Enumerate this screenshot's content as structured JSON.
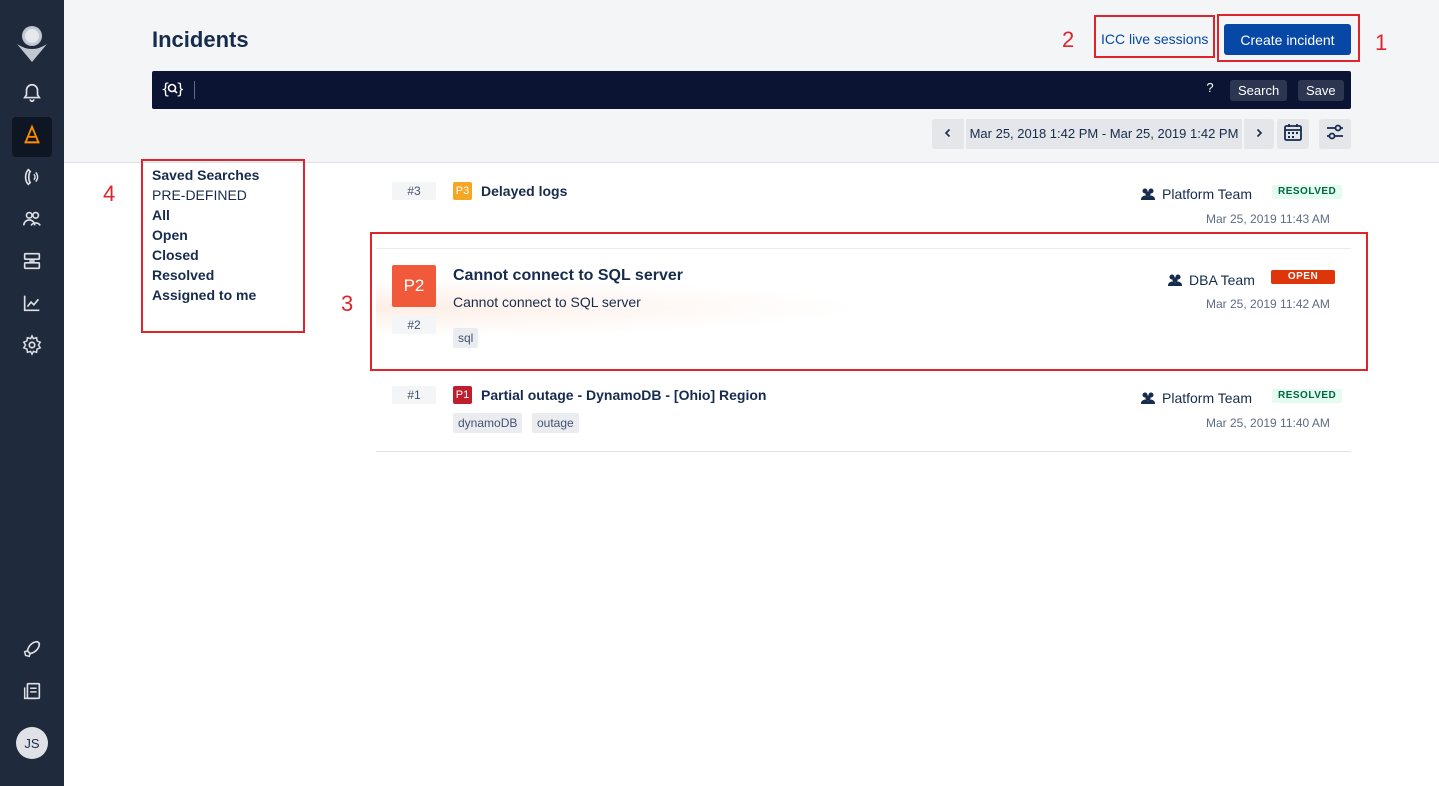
{
  "sidebar": {
    "items": [
      {
        "name": "alerts",
        "icon": "bell-icon"
      },
      {
        "name": "incidents",
        "icon": "cone-icon",
        "active": true
      },
      {
        "name": "on-call",
        "icon": "phone-icon"
      },
      {
        "name": "teams",
        "icon": "users-icon"
      },
      {
        "name": "services",
        "icon": "services-icon"
      },
      {
        "name": "analytics",
        "icon": "chart-icon"
      },
      {
        "name": "settings",
        "icon": "gear-icon"
      }
    ],
    "bottom": [
      {
        "name": "whats-new",
        "icon": "rocket-icon"
      },
      {
        "name": "docs",
        "icon": "docs-icon"
      }
    ],
    "avatar_initials": "JS",
    "accent_color": "#ff8b00"
  },
  "header": {
    "title": "Incidents",
    "icc_link": "ICC live sessions",
    "create_button": "Create incident"
  },
  "searchbar": {
    "icon_glyph": "{⍰}",
    "value": "",
    "help": "?",
    "search_label": "Search",
    "save_label": "Save"
  },
  "date_filter": {
    "range": "Mar 25, 2018 1:42 PM - Mar 25, 2019 1:42 PM",
    "prev": "‹",
    "next": "›"
  },
  "saved_searches": {
    "title": "Saved Searches",
    "section": "PRE-DEFINED",
    "items": [
      "All",
      "Open",
      "Closed",
      "Resolved",
      "Assigned to me"
    ]
  },
  "incidents": [
    {
      "number": "#3",
      "priority": "P3",
      "priority_color": "#f5a623",
      "title": "Delayed logs",
      "team": "Platform Team",
      "status": "RESOLVED",
      "time": "Mar 25, 2019 11:43 AM",
      "tags": []
    },
    {
      "number": "#2",
      "priority": "P2",
      "priority_color": "#f05a3a",
      "title": "Cannot connect to SQL server",
      "description": "Cannot connect to SQL server",
      "team": "DBA Team",
      "status": "OPEN",
      "time": "Mar 25, 2019 11:42 AM",
      "tags": [
        "sql"
      ]
    },
    {
      "number": "#1",
      "priority": "P1",
      "priority_color": "#bf1f2c",
      "title": "Partial outage - DynamoDB - [Ohio] Region",
      "team": "Platform Team",
      "status": "RESOLVED",
      "time": "Mar 25, 2019 11:40 AM",
      "tags": [
        "dynamoDB",
        "outage"
      ]
    }
  ],
  "annotations": [
    "1",
    "2",
    "3",
    "4"
  ]
}
